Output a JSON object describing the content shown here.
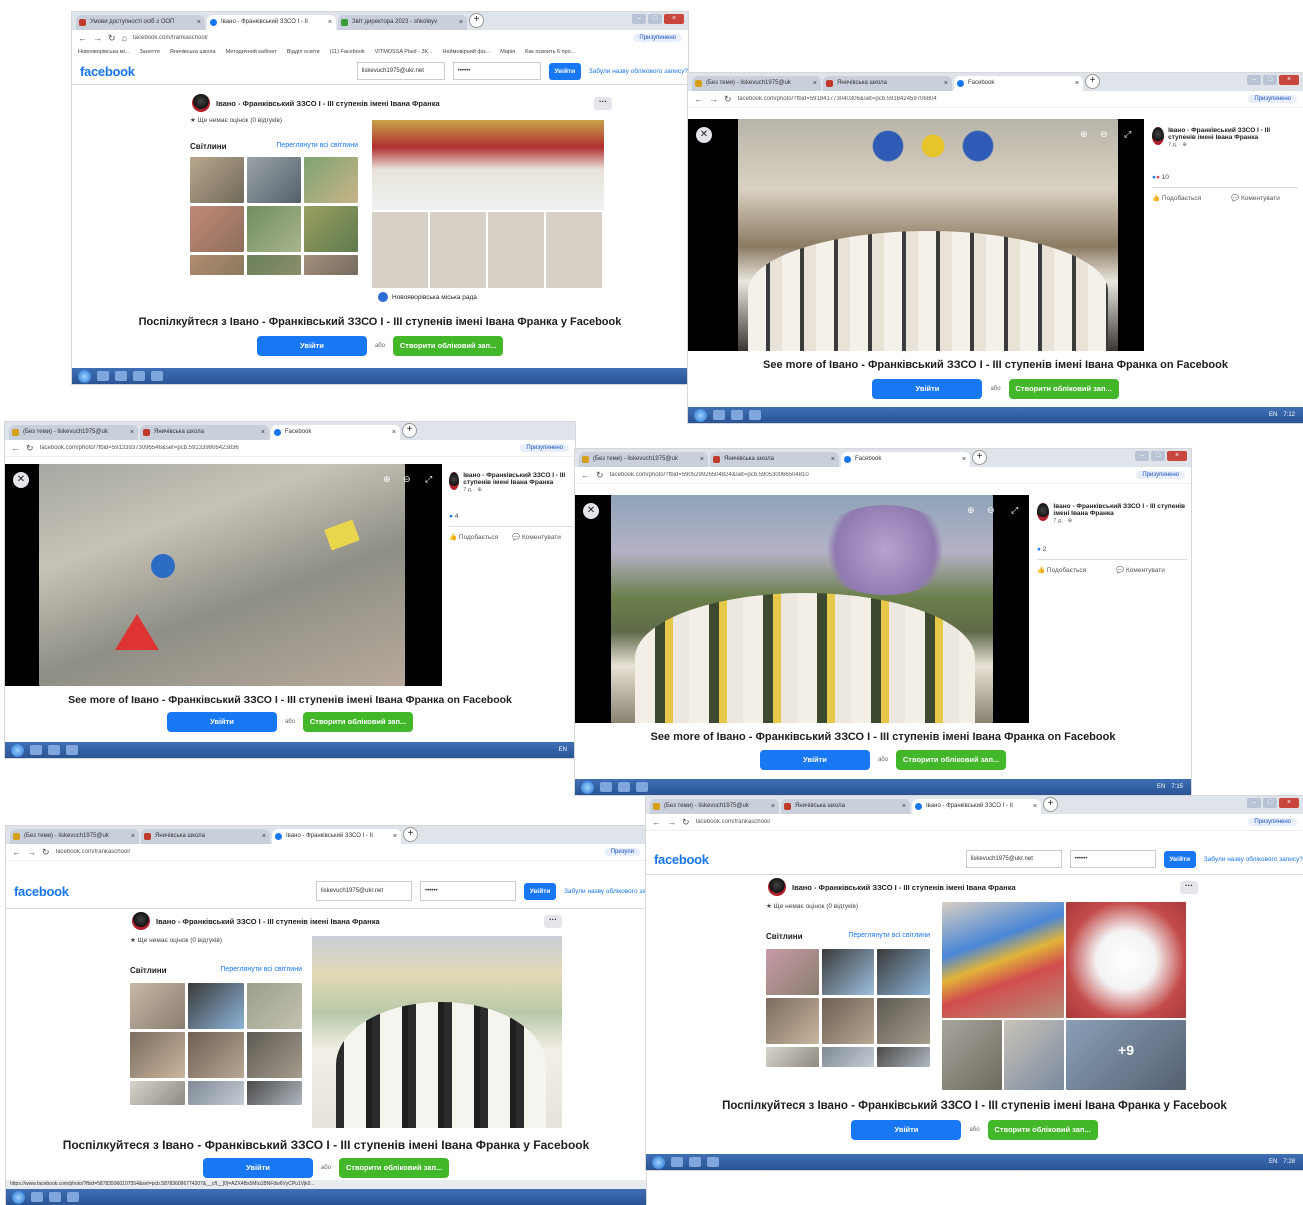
{
  "shots": {
    "a": {
      "tabs": [
        "Умови доступності осіб з ООП",
        "Івано - Франківський ЗЗСО І - ІІ",
        "Звіт директора 2023 - shkoleyv"
      ],
      "url": "facebook.com/frankaschool/",
      "profile": "Призупинено",
      "bookmarks": [
        "Новояворівська мі...",
        "Заняття",
        "Яничівська школа",
        "Методичний кабінет",
        "Відділ освіти",
        "(11) Facebook",
        "VITMOSSA Plaid - ЗК...",
        "Неймовірний фіз...",
        "Мapiя",
        "Как освоить 6 про..."
      ],
      "logo": "facebook",
      "email": "liskevuch1975@ukr.net",
      "password": "••••••",
      "login": "Увійти",
      "forgot": "Забули назву облікового запису?",
      "page_name": "Івано - Франківський ЗЗСО І - ІІІ ступенів імені Івана Франка",
      "rating": "Ще немає оцінок (0 відгуків)",
      "photos_title": "Світлини",
      "photos_link": "Переглянути всі світлини",
      "post_source": "Новояворівська міська рада",
      "cta": "Поспілкуйтеся з Івано - Франківський ЗЗСО І - ІІІ ступенів імені Івана Франка у Facebook",
      "btn_login": "Увійти",
      "or": "або",
      "btn_create": "Створити обліковий зап..."
    },
    "b": {
      "tabs": [
        "(Без теми) - liskevuch1975@uk",
        "Яничівська школа",
        "Facebook"
      ],
      "url": "facebook.com/photo/?fbid=591841773040306&set=pcb.591842459706804",
      "profile": "Призупинено",
      "page_name": "Івано - Франківський ЗЗСО І - ІІІ ступенів імені Івана Франка",
      "time": "7 д. · ⊕",
      "reactions": "10",
      "like": "Подобається",
      "comment": "Коментувати",
      "cta": "See more of Івано - Франківський ЗЗСО І - ІІІ ступенів імені Івана Франка on Facebook",
      "btn_login": "Увійти",
      "or": "або",
      "btn_create": "Створити обліковий зап...",
      "tray_lang": "EN",
      "tray_time": "7:12"
    },
    "c": {
      "tabs": [
        "(Без теми) - liskevuch1975@uk",
        "Яничівська школа",
        "Facebook"
      ],
      "url": "facebook.com/photo/?fbid=591339373096546&set=pcb.591339806423836",
      "profile": "Призупинено",
      "page_name": "Івано - Франківський ЗЗСО І - ІІІ ступенів імені Івана Франка",
      "time": "7 д. · ⊕",
      "reactions": "4",
      "like": "Подобається",
      "comment": "Коментувати",
      "cta": "See more of Івано - Франківський ЗЗСО І - ІІІ ступенів імені Івана Франка on Facebook",
      "btn_login": "Увійти",
      "or": "або",
      "btn_create": "Створити обліковий зап...",
      "tray_lang": "EN"
    },
    "d": {
      "tabs": [
        "(Без теми) - liskevuch1975@uk",
        "Яничівська школа",
        "Facebook"
      ],
      "url": "facebook.com/photo/?fbid=590529926504824&set=pcb.590530066504810",
      "profile": "Призупинено",
      "page_name": "Івано - Франківський ЗЗСО І - ІІІ ступенів імені Івана Франка",
      "time": "7 д. · ⊕",
      "reactions": "2",
      "like": "Подобається",
      "comment": "Коментувати",
      "cta": "See more of Івано - Франківський ЗЗСО І - ІІІ ступенів імені Івана Франка on Facebook",
      "btn_login": "Увійти",
      "or": "або",
      "btn_create": "Створити обліковий зап...",
      "tray_lang": "EN",
      "tray_time": "7:15"
    },
    "e": {
      "tabs": [
        "(Без теми) - liskevuch1975@uk",
        "Яничівська школа",
        "Івано - Франківський ЗЗСО І - ІІ"
      ],
      "url": "facebook.com/frankaschool/",
      "profile": "Призупи",
      "logo": "facebook",
      "email": "liskevuch1975@ukr.net",
      "password": "••••••",
      "login": "Увійти",
      "forgot": "Забули назву облікового за",
      "page_name": "Івано - Франківський ЗЗСО І - ІІІ ступенів імені Івана Франка",
      "rating": "Ще немає оцінок (0 відгуків)",
      "photos_title": "Світлини",
      "photos_link": "Переглянути всі світлини",
      "cta": "Поспілкуйтеся з Івано - Франківський ЗЗСО І - ІІІ ступенів імені Івана Франка у Facebook",
      "btn_login": "Увійти",
      "or": "або",
      "btn_create": "Створити обліковий зап...",
      "status_url": "https://www.facebook.com/photo/?fbid=587835960107554&set=pcb.587836096774207&__cft__[0]=AZX4Bx5MIu1BNFdw6VyCPu1Vjk0..."
    },
    "f": {
      "tabs": [
        "(Без теми) - liskevuch1975@uk",
        "Яничівська школа",
        "Івано - Франківський ЗЗСО І - ІІ"
      ],
      "url": "facebook.com/frankaschool/",
      "profile": "Призупинено",
      "logo": "facebook",
      "email": "liskevuch1975@ukr.net",
      "password": "••••••",
      "login": "Увійти",
      "forgot": "Забули назву облікового запису?",
      "page_name": "Івано - Франківський ЗЗСО І - ІІІ ступенів імені Івана Франка",
      "rating": "Ще немає оцінок (0 відгуків)",
      "photos_title": "Світлини",
      "photos_link": "Переглянути всі світлини",
      "more_count": "+9",
      "cta": "Поспілкуйтеся з Івано - Франківський ЗЗСО І - ІІІ ступенів імені Івана Франка у Facebook",
      "btn_login": "Увійти",
      "or": "або",
      "btn_create": "Створити обліковий зап...",
      "tray_lang": "EN",
      "tray_time": "7:28"
    }
  },
  "colors": {
    "fb_blue": "#1877f2",
    "fb_green": "#42b72a",
    "taskbar": "#2a5495"
  }
}
